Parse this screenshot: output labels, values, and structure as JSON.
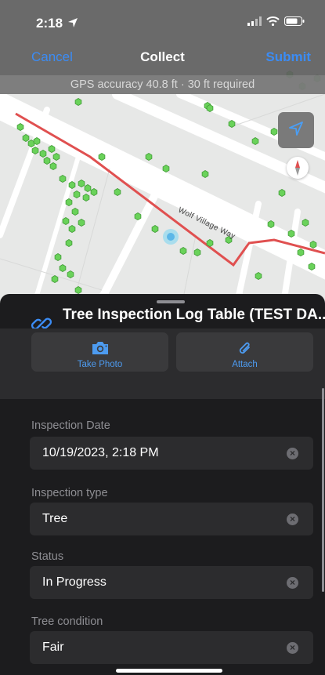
{
  "status_bar": {
    "time": "2:18",
    "location_icon": "location-arrow-icon",
    "signal_icon": "signal-icon",
    "wifi_icon": "wifi-icon",
    "battery_icon": "battery-icon"
  },
  "nav": {
    "cancel_label": "Cancel",
    "title": "Collect",
    "submit_label": "Submit",
    "accent_color": "#3b8cf5"
  },
  "gps": {
    "text": "GPS accuracy 40.8 ft · 30 ft required"
  },
  "map": {
    "road_name": "Wolf Village Way",
    "route_color": "#e05050",
    "tree_color": "#6ad25a",
    "locate_icon": "navigation-arrow-icon",
    "compass_icon": "compass-icon"
  },
  "sheet": {
    "title": "Tree Inspection Log Table (TEST DA...",
    "title_icon": "link-icon",
    "actions": [
      {
        "label": "Take Photo",
        "icon": "camera-icon"
      },
      {
        "label": "Attach",
        "icon": "paperclip-icon"
      }
    ],
    "fields": [
      {
        "label": "Inspection Date",
        "value": "10/19/2023, 2:18 PM"
      },
      {
        "label": "Inspection type",
        "value": "Tree"
      },
      {
        "label": "Status",
        "value": "In Progress"
      },
      {
        "label": "Tree condition",
        "value": "Fair"
      }
    ]
  }
}
